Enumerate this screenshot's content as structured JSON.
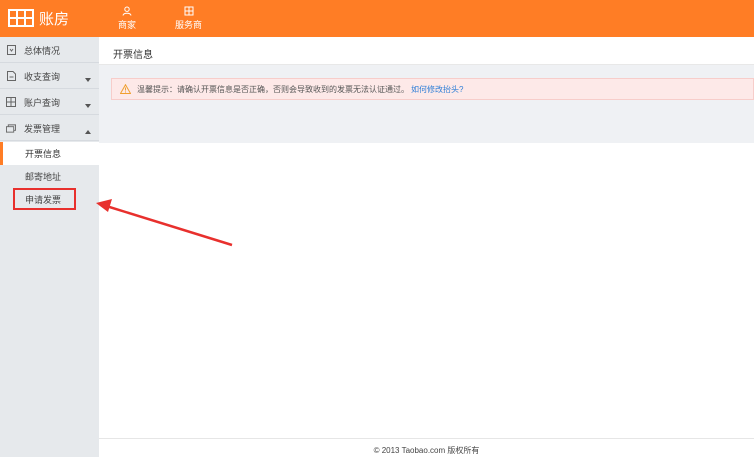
{
  "app": {
    "logo_text": "账房",
    "top_nav": [
      {
        "label": "商家",
        "icon": "user-icon"
      },
      {
        "label": "服务商",
        "icon": "service-icon"
      }
    ]
  },
  "sidebar": {
    "items": [
      {
        "label": "总体情况",
        "icon": "overview-icon"
      },
      {
        "label": "收支查询",
        "icon": "document-icon"
      },
      {
        "label": "账户查询",
        "icon": "account-grid-icon"
      },
      {
        "label": "发票管理",
        "icon": "invoice-icon"
      }
    ],
    "sub_items": [
      {
        "label": "开票信息",
        "active": true
      },
      {
        "label": "邮寄地址",
        "active": false
      },
      {
        "label": "申请发票",
        "active": false
      }
    ]
  },
  "main": {
    "title": "开票信息",
    "notice": {
      "text": "温馨提示：请确认开票信息是否正确，否则会导致收到的发票无法认证通过。",
      "link": "如何修改抬头?"
    },
    "footer": "© 2013 Taobao.com 版权所有"
  },
  "colors": {
    "brand": "#ff7d25",
    "highlight": "#e8302d",
    "link": "#2f7fd7"
  }
}
